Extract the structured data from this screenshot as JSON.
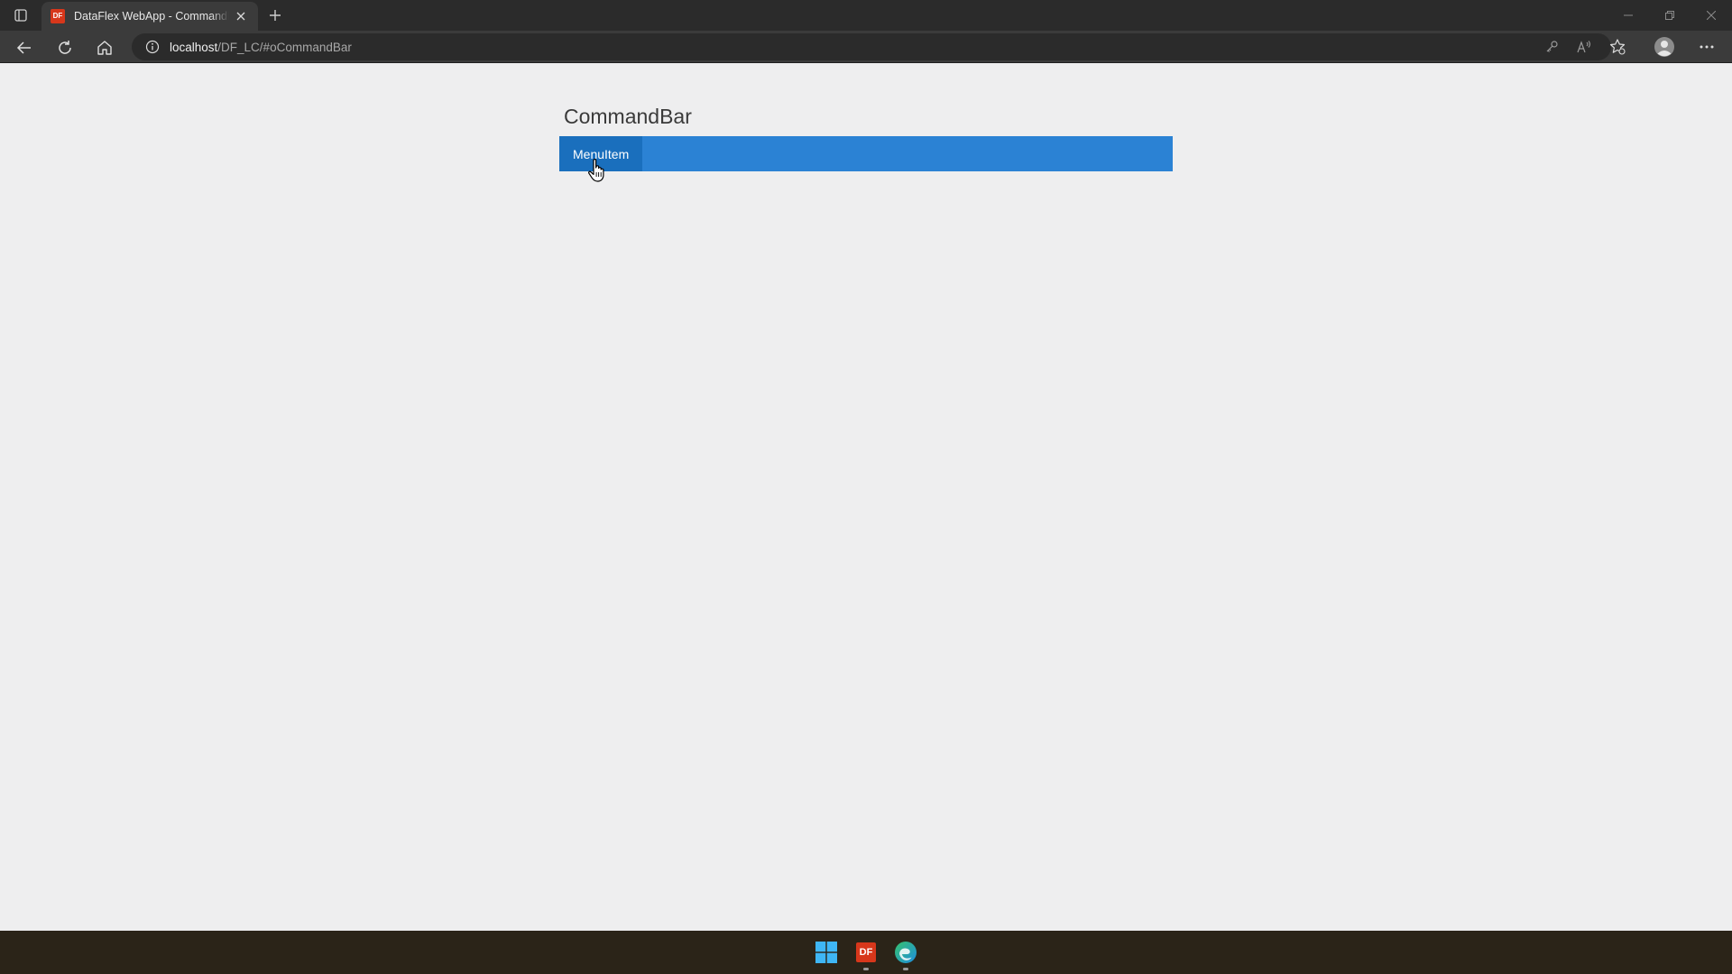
{
  "browser": {
    "tab": {
      "title": "DataFlex WebApp - CommandBar",
      "favicon_text": "DF",
      "favicon_color": "#d7371b"
    },
    "address": {
      "host": "localhost",
      "path": "/DF_LC/#oCommandBar"
    },
    "icons": {
      "tab_actions": "tab-actions-icon",
      "close_tab": "close-icon",
      "new_tab": "plus-icon",
      "back": "back-arrow-icon",
      "refresh": "refresh-icon",
      "home": "home-icon",
      "site_info": "info-icon",
      "key": "key-icon",
      "read_aloud": "read-aloud-icon",
      "favorites": "favorites-icon",
      "profile": "profile-icon",
      "more": "more-icon",
      "minimize": "minimize-icon",
      "restore": "restore-icon",
      "close_window": "close-icon"
    }
  },
  "page": {
    "heading": "CommandBar",
    "commandbar": {
      "color": "#2b82d4",
      "items": [
        {
          "label": "MenuItem",
          "state": "hover",
          "hover_color": "#1a6fbd"
        }
      ]
    }
  },
  "taskbar": {
    "background": "#2b2418",
    "apps": [
      {
        "name": "windows-start",
        "icon": "windows-logo-icon"
      },
      {
        "name": "dataflex",
        "label": "DF",
        "icon": "dataflex-icon",
        "running": true
      },
      {
        "name": "edge",
        "icon": "edge-icon",
        "running": true
      }
    ]
  }
}
